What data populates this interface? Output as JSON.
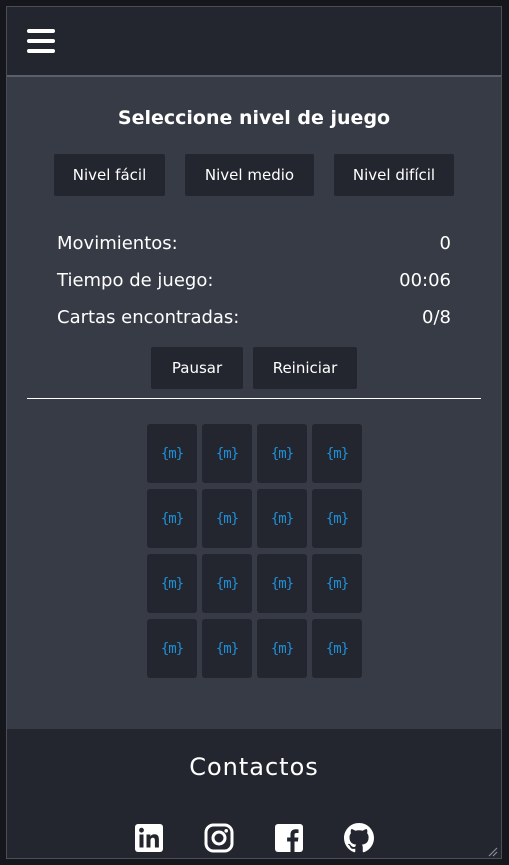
{
  "header": {
    "menu_icon": "hamburger-menu-icon"
  },
  "level": {
    "title": "Seleccione nivel de juego",
    "buttons": [
      "Nivel fácil",
      "Nivel medio",
      "Nivel difícil"
    ]
  },
  "stats": {
    "moves_label": "Movimientos:",
    "moves_value": "0",
    "time_label": "Tiempo de juego:",
    "time_value": "00:06",
    "found_label": "Cartas encontradas:",
    "found_value": "0/8"
  },
  "controls": {
    "pause": "Pausar",
    "restart": "Reiniciar"
  },
  "board": {
    "card_logo": "{m}",
    "card_icon": "m-braces-logo-icon",
    "rows": 4,
    "cols": 4,
    "accent": "#1f8fd8"
  },
  "footer": {
    "title": "Contactos",
    "socials": [
      "linkedin-icon",
      "instagram-icon",
      "facebook-icon",
      "github-icon"
    ]
  }
}
